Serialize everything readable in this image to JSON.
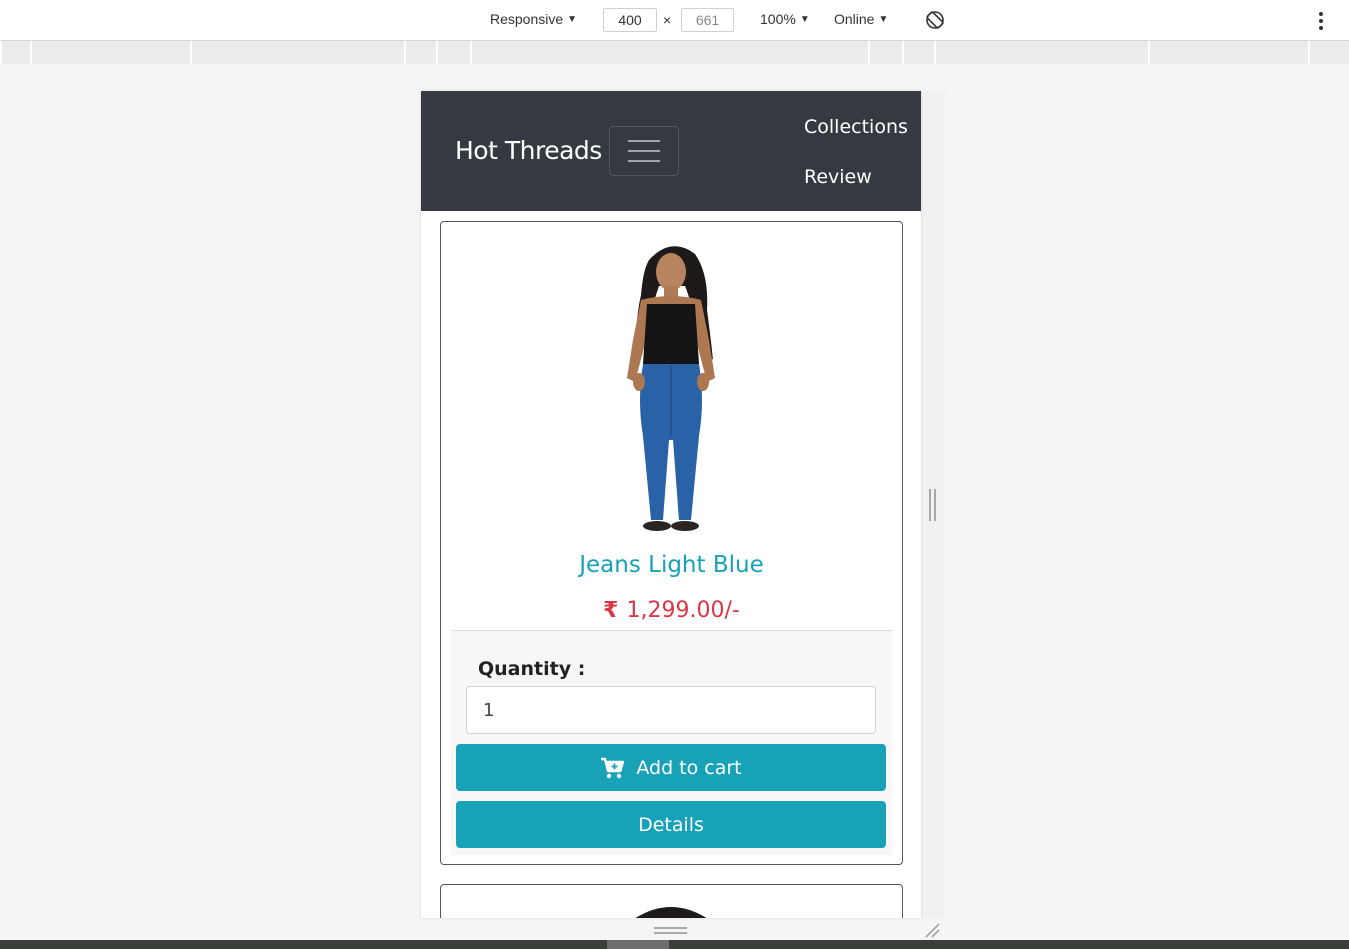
{
  "devtools": {
    "device_mode": "Responsive",
    "width": "400",
    "height": "661",
    "zoom": "100%",
    "network": "Online",
    "times": "×"
  },
  "page": {
    "navbar": {
      "brand": "Hot Threads",
      "links": [
        "Collections",
        "Review"
      ]
    },
    "products": [
      {
        "title": "Jeans Light Blue",
        "currency_symbol": "₹",
        "price": "1,299.00/-",
        "quantity_label": "Quantity :",
        "quantity_value": "1",
        "add_to_cart_label": "Add to cart",
        "details_label": "Details"
      }
    ]
  },
  "colors": {
    "navbar_bg": "#343a40",
    "accent": "#17a2b8",
    "price": "#dc3545"
  }
}
